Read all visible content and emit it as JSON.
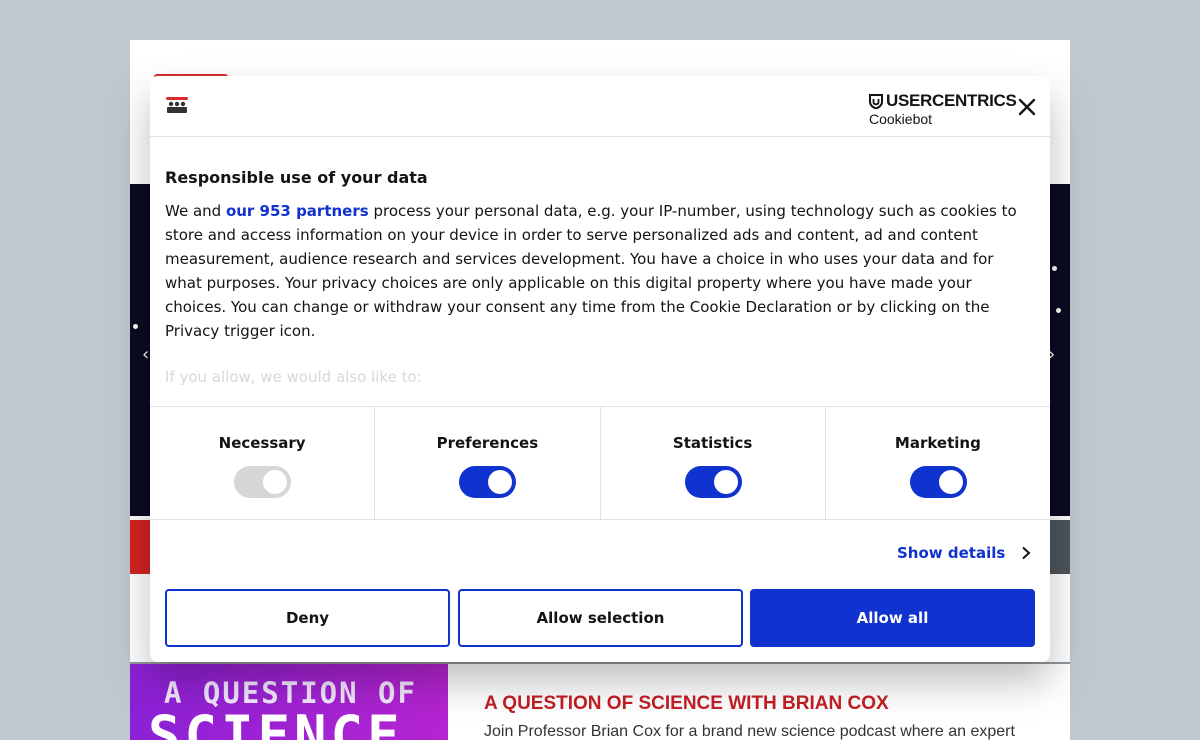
{
  "page": {
    "podcast_art_line1": "A QUESTION OF",
    "podcast_art_line2": "SCIENCE",
    "podcast_title": "A QUESTION OF SCIENCE WITH BRIAN COX",
    "podcast_desc": "Join Professor Brian Cox for a brand new science podcast where an expert"
  },
  "dialog": {
    "brand_name": "USERCENTRICS",
    "brand_product": "Cookiebot",
    "close_icon": "close-icon",
    "title": "Responsible use of your data",
    "text_before_link": "We and ",
    "partners_link": "our 953 partners",
    "text_after_link": " process your personal data, e.g. your IP-number, using technology such as cookies to store and access information on your device in order to serve personalized ads and content, ad and content measurement, audience research and services development. You have a choice in who uses your data and for what purposes. Your privacy choices are only applicable on this digital property where you have made your choices. You can change or withdraw your consent any time from the Cookie Declaration or by clicking on the Privacy trigger icon.",
    "faded_text": "If you allow, we would also like to:",
    "categories": [
      {
        "label": "Necessary",
        "enabled": true,
        "locked": true
      },
      {
        "label": "Preferences",
        "enabled": true,
        "locked": false
      },
      {
        "label": "Statistics",
        "enabled": true,
        "locked": false
      },
      {
        "label": "Marketing",
        "enabled": true,
        "locked": false
      }
    ],
    "show_details": "Show details",
    "buttons": {
      "deny": "Deny",
      "allow_selection": "Allow selection",
      "allow_all": "Allow all"
    },
    "colors": {
      "accent": "#1032cf",
      "toggle_disabled": "#d6d6d6"
    }
  }
}
